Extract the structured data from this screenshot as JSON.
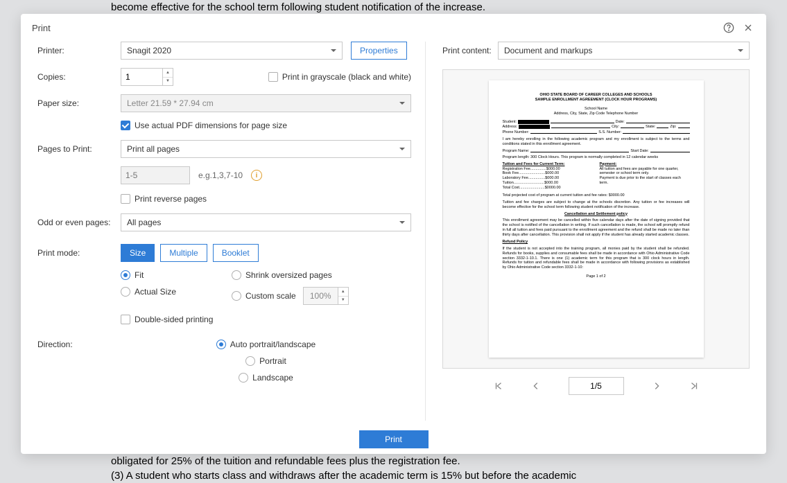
{
  "bg": {
    "top": "become effective for the school term following student notification of the increase.",
    "bottom1": "obligated for 25% of the tuition and refundable fees plus the registration fee.",
    "bottom2": "(3) A student who starts class and withdraws after the academic term is 15% but before the academic"
  },
  "dialog": {
    "title": "Print",
    "labels": {
      "printer": "Printer:",
      "copies": "Copies:",
      "paperSize": "Paper size:",
      "pagesToPrint": "Pages to Print:",
      "oddEven": "Odd or even pages:",
      "printMode": "Print mode:",
      "direction": "Direction:",
      "printContent": "Print content:"
    },
    "printer": {
      "value": "Snagit 2020",
      "propertiesBtn": "Properties"
    },
    "copies": {
      "value": "1",
      "grayscaleLabel": "Print in grayscale (black and white)"
    },
    "paperSize": {
      "value": "Letter 21.59 * 27.94 cm",
      "actualDimsLabel": "Use actual PDF dimensions for page size"
    },
    "pagesToPrint": {
      "value": "Print all pages",
      "rangePlaceholder": "1-5",
      "hint": "e.g.1,3,7-10",
      "reverseLabel": "Print reverse pages"
    },
    "oddEven": {
      "value": "All pages"
    },
    "modeBtns": {
      "size": "Size",
      "multiple": "Multiple",
      "booklet": "Booklet"
    },
    "sizeMode": {
      "fit": "Fit",
      "actual": "Actual Size",
      "shrink": "Shrink oversized pages",
      "custom": "Custom scale",
      "scaleValue": "100%",
      "doubleSided": "Double-sided printing"
    },
    "direction": {
      "auto": "Auto portrait/landscape",
      "portrait": "Portrait",
      "landscape": "Landscape"
    },
    "printContent": {
      "value": "Document and markups"
    },
    "pager": {
      "position": "1/5"
    },
    "footer": {
      "printBtn": "Print"
    }
  },
  "preview": {
    "h1": "OHIO STATE BOARD OF CAREER COLLEGES AND SCHOOLS",
    "h2": "SAMPLE ENROLLMENT AGREEMENT (CLOCK HOUR PROGRAMS)",
    "schoolName": "School Name",
    "addressLine": "Address, City, State, Zip Code  Telephone Number",
    "fields": {
      "student": "Student:",
      "date": "Date:",
      "address": "Address:",
      "city": "City:",
      "state": "State:",
      "zip": "Zip:",
      "phone": "Phone Number:",
      "ssn": "S.S. Number:"
    },
    "enrollPara": "I am hereby enrolling in the following academic program and my enrollment is subject to the terms and conditions stated in this enrollment agreement.",
    "programName": "Program Name:",
    "startDate": "Start Date:",
    "programLength": "Program length:  300 Clock Hours.  This program is normally completed in 12 calendar weeks",
    "tuitionHeader": "Tuition and Fees for Current Term:",
    "paymentHeader": "Payment:",
    "regFee": "Registration Fee...............$000.00",
    "bookFee": "Book Fee.........................$000.00",
    "labFee": "Laboratory Fee................$000.00",
    "tuition": "Tuition.............................$000.00",
    "total": "Total Cost........................$0000.00",
    "payText1": "All tuition and fees are payable for one quarter, semester or school term only.",
    "payText2": "Payment is due prior to the start of classes each term.",
    "projected": "Total projected cost of program at current tuition and fee rates:  $0000.00",
    "changePara": "Tuition and fee charges are subject to change at the schools discretion.  Any tuition or fee increases will become effective for the school term following student notification of the increase.",
    "cancelHeader": "Cancellation and Settlement policy",
    "cancelPara": "This enrollment agreement may be cancelled within five calendar days after the date of signing provided that the school is notified of the cancellation in writing.  If such cancellation is made, the school will promptly refund in full all tuition and fees paid pursuant to the enrollment agreement and the refund shall be made no later than thirty days after cancellation. This provision shall not apply if the student has already started academic classes.",
    "refundHeader": "Refund Policy",
    "refundPara": "If the student is not accepted into the training program, all monies paid by the student shall be refunded. Refunds for books, supplies and consumable fees shall be made in accordance with Ohio Administrative Code section 3332-1-10.1. There is one (1) academic term for this program that is 300 clock hours in length. Refunds for tuition and refundable fees shall be made in accordance with following provisions as established by Ohio Administrative Code section 3332-1-10:",
    "pageNum": "Page 1 of 2"
  }
}
